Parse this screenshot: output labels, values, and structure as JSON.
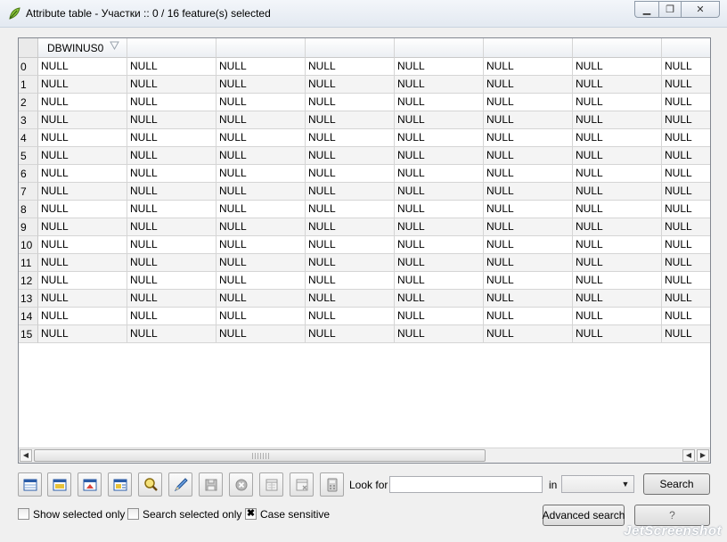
{
  "window": {
    "title": "Attribute table - Участки :: 0 / 16 feature(s) selected",
    "icon": "qgis-leaf-icon"
  },
  "table": {
    "columns": [
      "DBWINUS0",
      "",
      "",
      "",
      "",
      "",
      "",
      ""
    ],
    "row_ids": [
      "0",
      "1",
      "2",
      "3",
      "4",
      "5",
      "6",
      "7",
      "8",
      "9",
      "10",
      "11",
      "12",
      "13",
      "14",
      "15"
    ],
    "cell_value": "NULL"
  },
  "toolbar": {
    "icons": [
      "unselect-all-icon",
      "select-all-icon",
      "invert-selection-icon",
      "move-selection-to-top-icon",
      "zoom-to-selection-icon",
      "toggle-editing-icon",
      "save-edits-icon",
      "delete-selected-icon",
      "new-column-icon",
      "delete-column-icon",
      "field-calculator-icon"
    ],
    "look_for_label": "Look for",
    "search_value": "",
    "in_label": "in",
    "field_selected": "",
    "search_button": "Search",
    "advanced_search_button": "Advanced search",
    "close_button": "?"
  },
  "options": {
    "show_selected_only": "Show selected only",
    "search_selected_only": "Search selected only",
    "case_sensitive": "Case sensitive",
    "case_sensitive_checked": "✖"
  },
  "watermark": "JetScreenshot"
}
